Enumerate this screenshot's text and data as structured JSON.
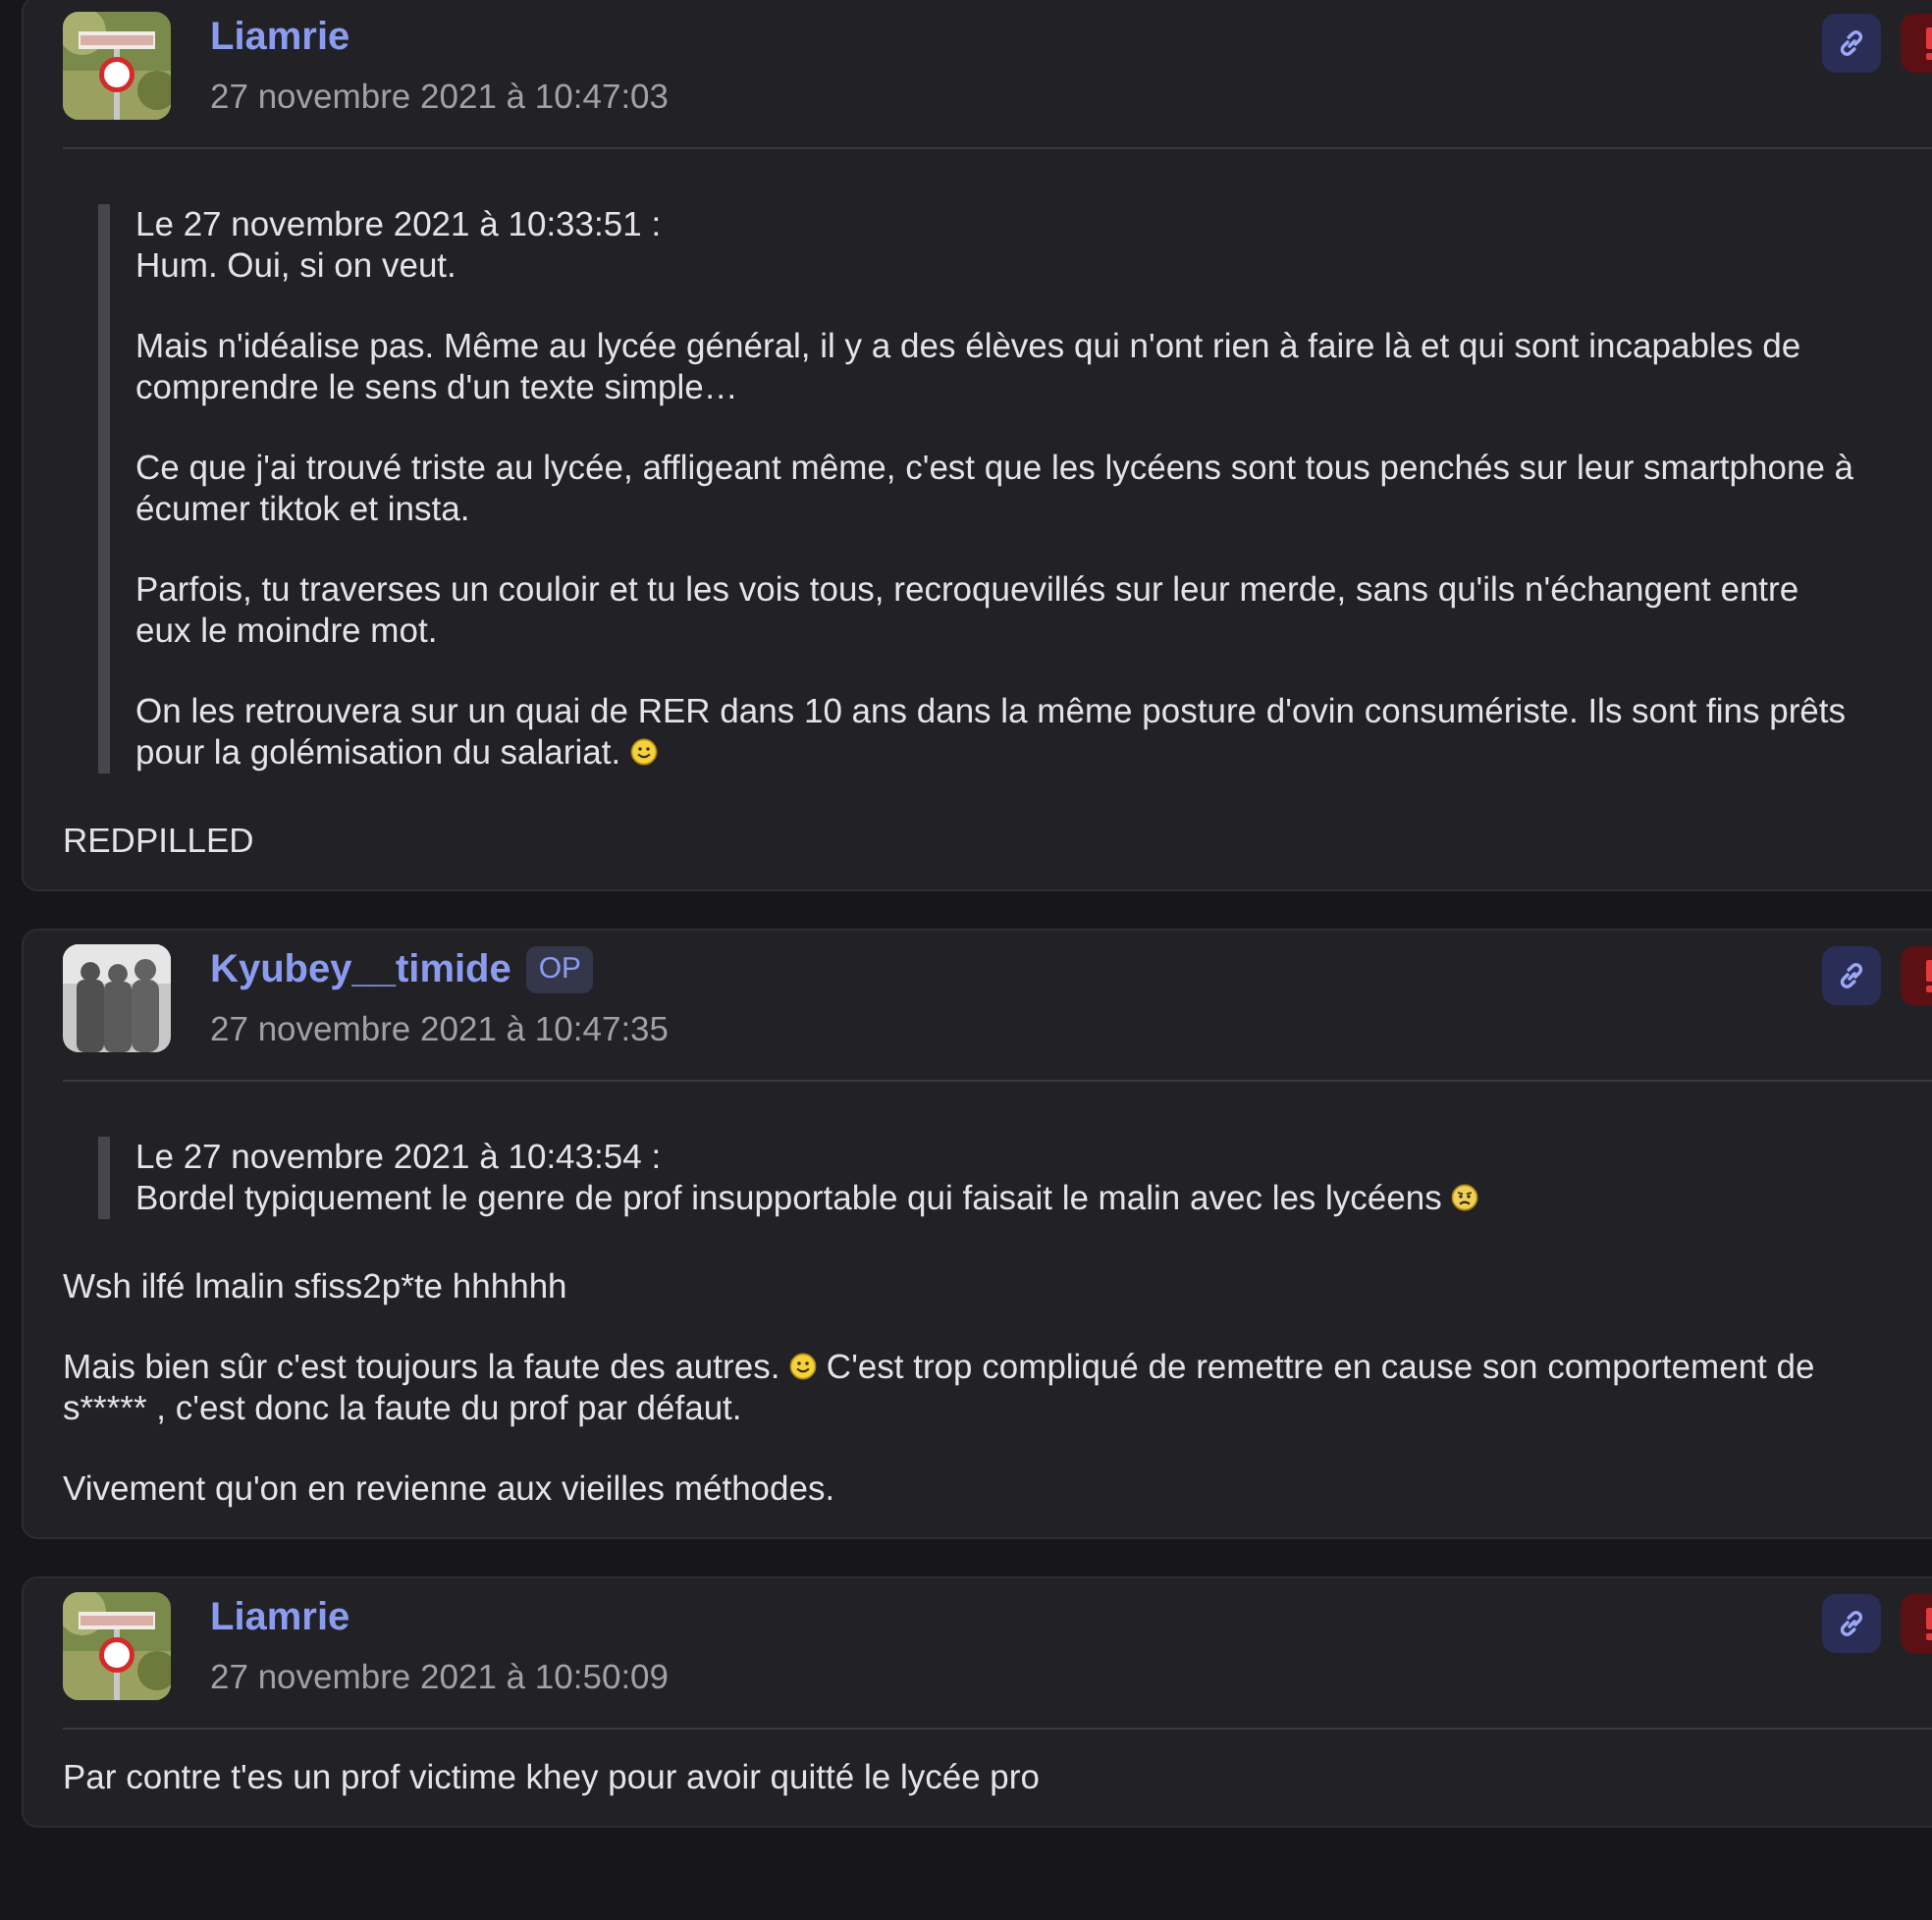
{
  "posts": [
    {
      "author": "Liamrie",
      "date": "27 novembre 2021 à 10:47:03",
      "quote": {
        "header": "Le 27 novembre 2021 à 10:33:51 :",
        "paragraphs": [
          [
            {
              "kind": "text",
              "text": "Hum. Oui, si on veut."
            }
          ],
          [
            {
              "kind": "text",
              "text": "Mais n'idéalise pas. Même au lycée général, il y a des élèves qui n'ont rien à faire là et qui sont incapables de comprendre le sens d'un texte simple…"
            }
          ],
          [
            {
              "kind": "text",
              "text": "Ce que j'ai trouvé triste au lycée, affligeant même, c'est que les lycéens sont tous penchés sur leur smartphone à écumer tiktok et insta."
            }
          ],
          [
            {
              "kind": "text",
              "text": "Parfois, tu traverses un couloir et tu les vois tous, recroquevillés sur leur merde, sans qu'ils n'échangent entre eux le moindre mot."
            }
          ],
          [
            {
              "kind": "text",
              "text": "On les retrouvera sur un quai de RER dans 10 ans dans la même posture d'ovin consumériste. Ils sont fins prêts pour la golémisation du salariat. "
            },
            {
              "kind": "smiley"
            }
          ]
        ]
      },
      "paragraphs": [
        [
          {
            "kind": "text",
            "text": "REDPILLED"
          }
        ]
      ]
    },
    {
      "author": "Kyubey__timide",
      "badge": "OP",
      "date": "27 novembre 2021 à 10:47:35",
      "quote": {
        "header": "Le 27 novembre 2021 à 10:43:54 :",
        "paragraphs": [
          [
            {
              "kind": "text",
              "text": "Bordel typiquement le genre de prof insupportable qui faisait le malin avec les lycéens "
            },
            {
              "kind": "worried"
            }
          ]
        ]
      },
      "paragraphs": [
        [
          {
            "kind": "text",
            "text": "Wsh ilfé lmalin sfiss2p*te hhhhhh"
          }
        ],
        [
          {
            "kind": "text",
            "text": "Mais bien sûr c'est toujours la faute des autres. "
          },
          {
            "kind": "smiley"
          },
          {
            "kind": "text",
            "text": " C'est trop compliqué de remettre en cause son comportement de s***** , c'est donc la faute du prof par défaut."
          }
        ],
        [
          {
            "kind": "text",
            "text": "Vivement qu'on en revienne aux vieilles méthodes."
          }
        ]
      ]
    },
    {
      "author": "Liamrie",
      "date": "27 novembre 2021 à 10:50:09",
      "paragraphs": [
        [
          {
            "kind": "text",
            "text": "Par contre t'es un prof victime khey pour avoir quitté le lycée pro"
          }
        ]
      ]
    }
  ]
}
